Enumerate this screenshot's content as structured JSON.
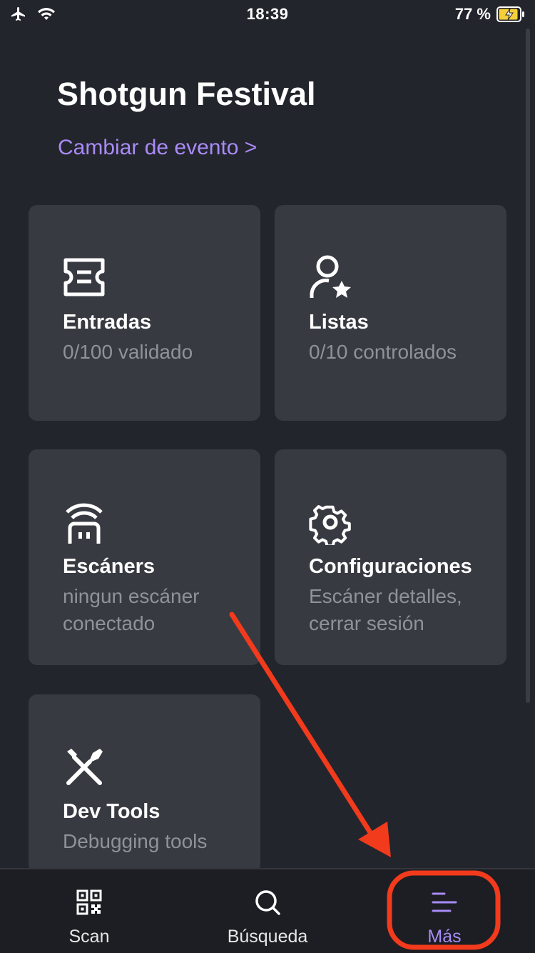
{
  "status_bar": {
    "time": "18:39",
    "battery": "77 %"
  },
  "header": {
    "title": "Shotgun Festival",
    "change_event": "Cambiar de evento >"
  },
  "cards": [
    {
      "title": "Entradas",
      "subtitle": "0/100 validado",
      "icon": "ticket-icon"
    },
    {
      "title": "Listas",
      "subtitle": "0/10 controlados",
      "icon": "user-star-icon"
    },
    {
      "title": "Escáners",
      "subtitle": "ningun escáner conectado",
      "icon": "scanner-wifi-icon"
    },
    {
      "title": "Configuraciones",
      "subtitle": "Escáner detalles, cerrar sesión",
      "icon": "gear-icon"
    },
    {
      "title": "Dev Tools",
      "subtitle": "Debugging tools",
      "icon": "tools-icon"
    }
  ],
  "tabs": [
    {
      "label": "Scan",
      "icon": "qr-code-icon"
    },
    {
      "label": "Búsqueda",
      "icon": "search-icon"
    },
    {
      "label": "Más",
      "icon": "menu-icon",
      "active": true
    }
  ],
  "colors": {
    "background": "#23252c",
    "card": "#383a41",
    "accent": "#a98bf7",
    "annotation": "#f23a1c"
  }
}
